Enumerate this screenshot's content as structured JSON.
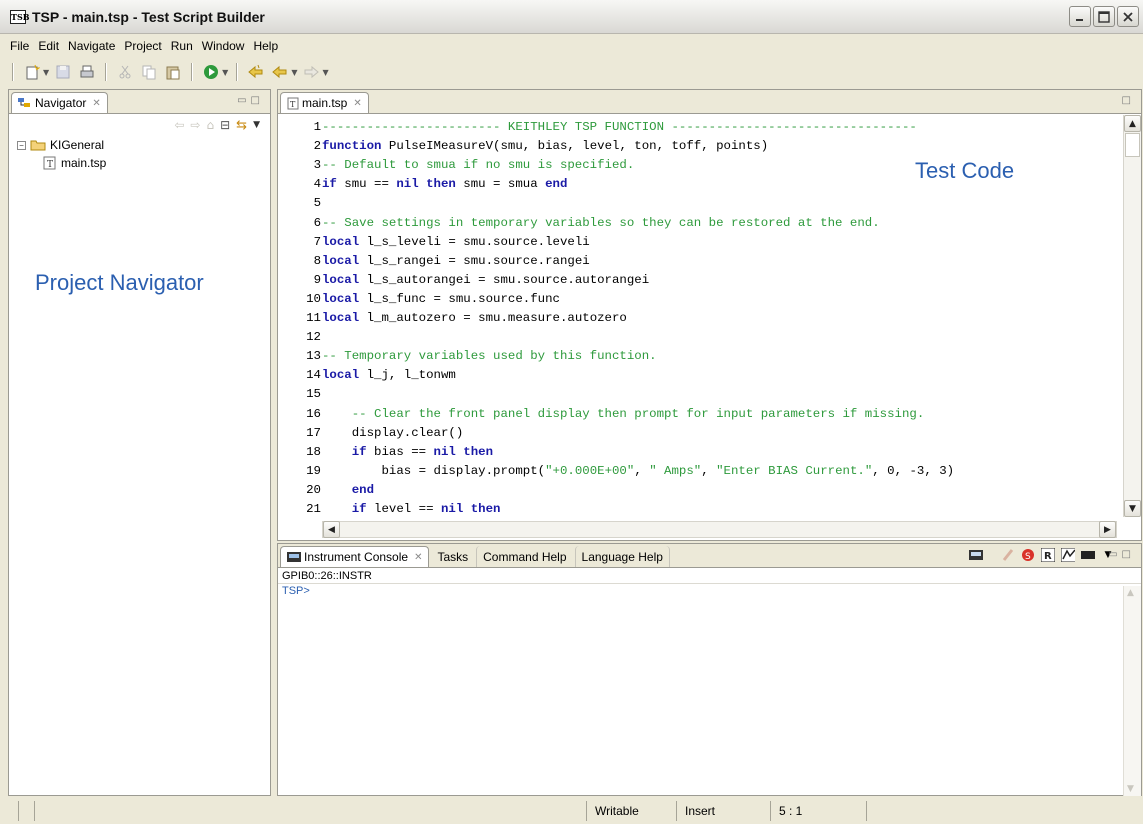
{
  "window": {
    "title": "TSP - main.tsp - Test Script Builder",
    "logo_text": "TSB"
  },
  "menu": [
    "File",
    "Edit",
    "Navigate",
    "Project",
    "Run",
    "Window",
    "Help"
  ],
  "navigator": {
    "tab_label": "Navigator",
    "tree": {
      "project": "KIGeneral",
      "files": [
        "main.tsp"
      ]
    },
    "annotation": "Project Navigator"
  },
  "editor": {
    "tab_label": "main.tsp",
    "annotation": "Test Code",
    "lines": [
      {
        "n": "1",
        "parts": [
          [
            "cm",
            "------------------------ KEITHLEY TSP FUNCTION ---------------------------------"
          ]
        ]
      },
      {
        "n": "2",
        "parts": [
          [
            "kw",
            "function"
          ],
          [
            "",
            " PulseIMeasureV(smu, bias, level, ton, toff, points)"
          ]
        ]
      },
      {
        "n": "3",
        "parts": [
          [
            "cm",
            "-- Default to smua if no smu is specified."
          ]
        ]
      },
      {
        "n": "4",
        "parts": [
          [
            "kw",
            "if"
          ],
          [
            "",
            " smu == "
          ],
          [
            "kw",
            "nil"
          ],
          [
            "",
            " "
          ],
          [
            "kw",
            "then"
          ],
          [
            "",
            " smu = smua "
          ],
          [
            "kw",
            "end"
          ]
        ]
      },
      {
        "n": "5",
        "parts": []
      },
      {
        "n": "6",
        "parts": [
          [
            "cm",
            "-- Save settings in temporary variables so they can be restored at the end."
          ]
        ]
      },
      {
        "n": "7",
        "parts": [
          [
            "kw",
            "local"
          ],
          [
            "",
            " l_s_leveli = smu.source.leveli"
          ]
        ]
      },
      {
        "n": "8",
        "parts": [
          [
            "kw",
            "local"
          ],
          [
            "",
            " l_s_rangei = smu.source.rangei"
          ]
        ]
      },
      {
        "n": "9",
        "parts": [
          [
            "kw",
            "local"
          ],
          [
            "",
            " l_s_autorangei = smu.source.autorangei"
          ]
        ]
      },
      {
        "n": "10",
        "parts": [
          [
            "kw",
            "local"
          ],
          [
            "",
            " l_s_func = smu.source.func"
          ]
        ]
      },
      {
        "n": "11",
        "parts": [
          [
            "kw",
            "local"
          ],
          [
            "",
            " l_m_autozero = smu.measure.autozero"
          ]
        ]
      },
      {
        "n": "12",
        "parts": []
      },
      {
        "n": "13",
        "parts": [
          [
            "cm",
            "-- Temporary variables used by this function."
          ]
        ]
      },
      {
        "n": "14",
        "parts": [
          [
            "kw",
            "local"
          ],
          [
            "",
            " l_j, l_tonwm"
          ]
        ]
      },
      {
        "n": "15",
        "parts": []
      },
      {
        "n": "16",
        "parts": [
          [
            "",
            "    "
          ],
          [
            "cm",
            "-- Clear the front panel display then prompt for input parameters if missing."
          ]
        ]
      },
      {
        "n": "17",
        "parts": [
          [
            "",
            "    display.clear()"
          ]
        ]
      },
      {
        "n": "18",
        "parts": [
          [
            "",
            "    "
          ],
          [
            "kw",
            "if"
          ],
          [
            "",
            " bias == "
          ],
          [
            "kw",
            "nil"
          ],
          [
            "",
            " "
          ],
          [
            "kw",
            "then"
          ]
        ]
      },
      {
        "n": "19",
        "parts": [
          [
            "",
            "        bias = display.prompt("
          ],
          [
            "st",
            "\"+0.000E+00\""
          ],
          [
            "",
            ", "
          ],
          [
            "st",
            "\" Amps\""
          ],
          [
            "",
            ", "
          ],
          [
            "st",
            "\"Enter BIAS Current.\""
          ],
          [
            "",
            ", 0, -3, 3)"
          ]
        ]
      },
      {
        "n": "20",
        "parts": [
          [
            "",
            "    "
          ],
          [
            "kw",
            "end"
          ]
        ]
      },
      {
        "n": "21",
        "parts": [
          [
            "",
            "    "
          ],
          [
            "kw",
            "if"
          ],
          [
            "",
            " level == "
          ],
          [
            "kw",
            "nil"
          ],
          [
            "",
            " "
          ],
          [
            "kw",
            "then"
          ]
        ]
      }
    ]
  },
  "console": {
    "tabs": [
      "Instrument Console",
      "Tasks",
      "Command Help",
      "Language Help"
    ],
    "path": "GPIB0::26::INSTR",
    "prompt": "TSP>"
  },
  "statusbar": {
    "mode": "Writable",
    "insert": "Insert",
    "position": "5 : 1"
  },
  "colors": {
    "keyword": "#1a1aa6",
    "comment": "#2e9a3c",
    "annotation": "#2b5fb0"
  }
}
